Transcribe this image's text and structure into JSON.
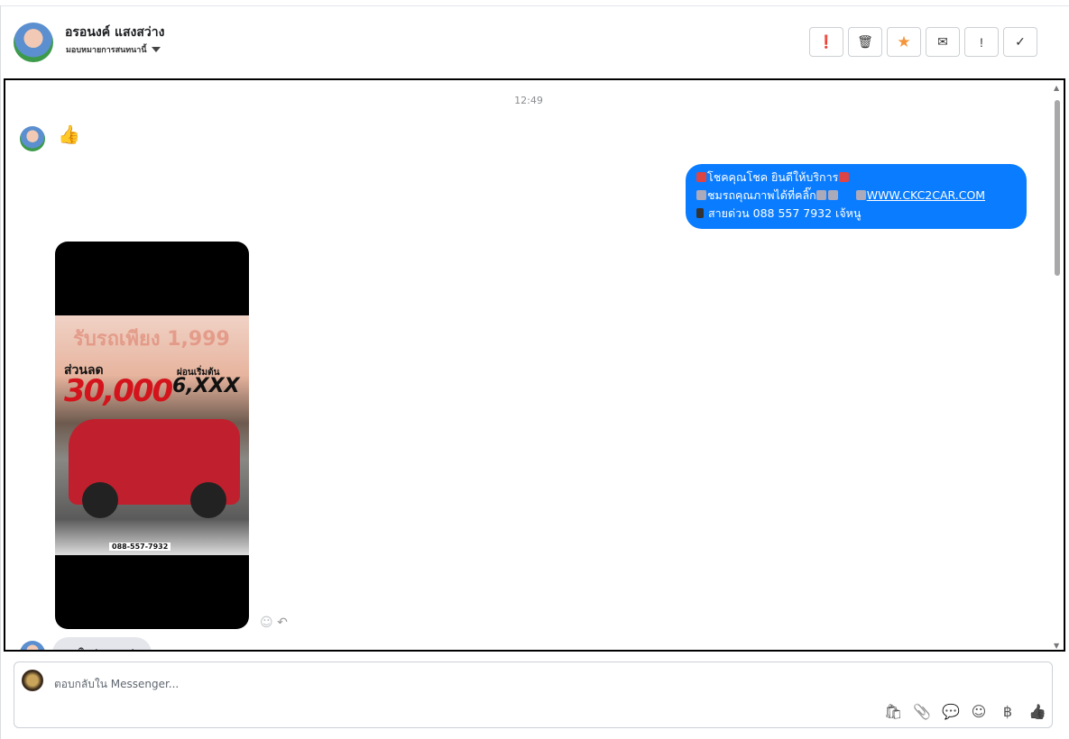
{
  "header": {
    "name": "อรอนงค์ แสงสว่าง",
    "assign_label": "มอบหมายการสนทนานี้"
  },
  "actions": [
    {
      "name": "spam",
      "icon": "❗"
    },
    {
      "name": "delete",
      "icon": "🗑"
    },
    {
      "name": "star",
      "icon": "★",
      "color": "#f5953b"
    },
    {
      "name": "mark-unread",
      "icon": "✉"
    },
    {
      "name": "follow-up",
      "icon": "!"
    },
    {
      "name": "done",
      "icon": "✓"
    }
  ],
  "chat": {
    "timestamp": "12:49",
    "like_icon": "👍",
    "outgoing": {
      "line1": "โชคคุณโชค ยินดีให้บริการ",
      "line2": "ชมรถคุณภาพได้ที่คลิ๊ก",
      "link": "WWW.CKC2CAR.COM",
      "line3": "สายด่วน 088 557 7932 เจ้หนู"
    },
    "poster": {
      "headline": "รับรถเพียง 1,999",
      "discount_label": "ส่วนลด",
      "discount": "30,000",
      "installment_label": "ผ่อนเริ่มต้น",
      "installment": "6,XXX",
      "phone": "088-557-7932"
    },
    "incoming_partial": "สนใจผ่อนรถค่ะ"
  },
  "composer": {
    "placeholder": "ตอบกลับใน Messenger...",
    "tools": [
      "🛍",
      "📎",
      "💬",
      "☺",
      "฿",
      "👍"
    ]
  }
}
